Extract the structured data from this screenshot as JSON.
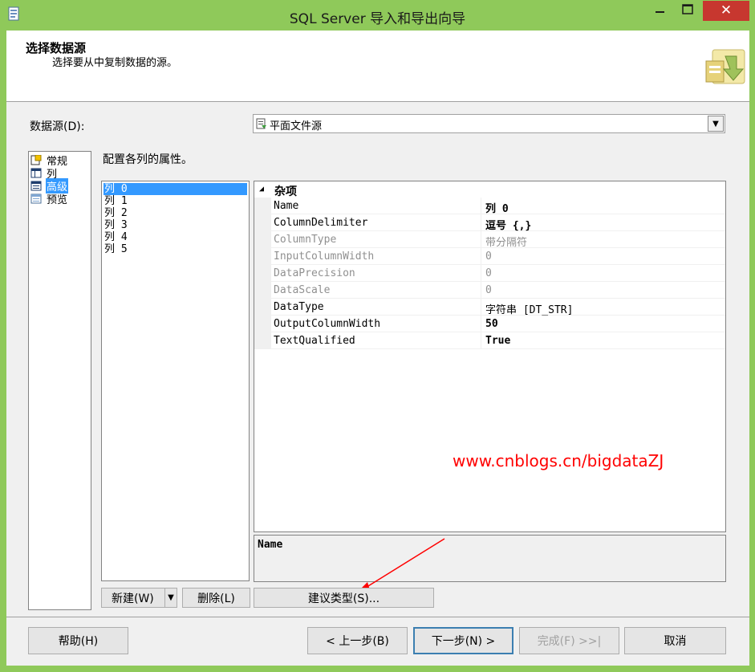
{
  "window": {
    "title": "SQL Server 导入和导出向导",
    "close_glyph": "✕"
  },
  "header": {
    "title": "选择数据源",
    "subtitle": "选择要从中复制数据的源。"
  },
  "datasource": {
    "label": "数据源(D):",
    "selected": "平面文件源"
  },
  "nav": {
    "items": [
      {
        "label": "常规",
        "icon": "general-icon",
        "selected": false
      },
      {
        "label": "列",
        "icon": "columns-icon",
        "selected": false
      },
      {
        "label": "高级",
        "icon": "advanced-icon",
        "selected": true
      },
      {
        "label": "预览",
        "icon": "preview-icon",
        "selected": false
      }
    ]
  },
  "configure_label": "配置各列的属性。",
  "columns": [
    "列 0",
    "列 1",
    "列 2",
    "列 3",
    "列 4",
    "列 5"
  ],
  "selected_column": 0,
  "property_grid": {
    "category": "杂项",
    "rows": [
      {
        "name": "Name",
        "value": "列 0",
        "dim": false,
        "bold": true
      },
      {
        "name": "ColumnDelimiter",
        "value": "逗号 {,}",
        "dim": false,
        "bold": true
      },
      {
        "name": "ColumnType",
        "value": "带分隔符",
        "dim": true,
        "bold": false
      },
      {
        "name": "InputColumnWidth",
        "value": "0",
        "dim": true,
        "bold": false
      },
      {
        "name": "DataPrecision",
        "value": "0",
        "dim": true,
        "bold": false
      },
      {
        "name": "DataScale",
        "value": "0",
        "dim": true,
        "bold": false
      },
      {
        "name": "DataType",
        "value": "字符串 [DT_STR]",
        "dim": false,
        "bold": false
      },
      {
        "name": "OutputColumnWidth",
        "value": "50",
        "dim": false,
        "bold": true
      },
      {
        "name": "TextQualified",
        "value": "True",
        "dim": false,
        "bold": true
      }
    ],
    "description_title": "Name"
  },
  "buttons": {
    "new": "新建(W)",
    "delete": "删除(L)",
    "suggest": "建议类型(S)...",
    "help": "帮助(H)",
    "prev": "< 上一步(B)",
    "next": "下一步(N) >",
    "finish": "完成(F) >>|",
    "cancel": "取消"
  },
  "watermark": "www.cnblogs.cn/bigdataZJ",
  "colors": {
    "window_frame": "#8fc95a",
    "selection": "#3399ff",
    "close_button": "#c7372f",
    "annotation": "#ff0000"
  }
}
